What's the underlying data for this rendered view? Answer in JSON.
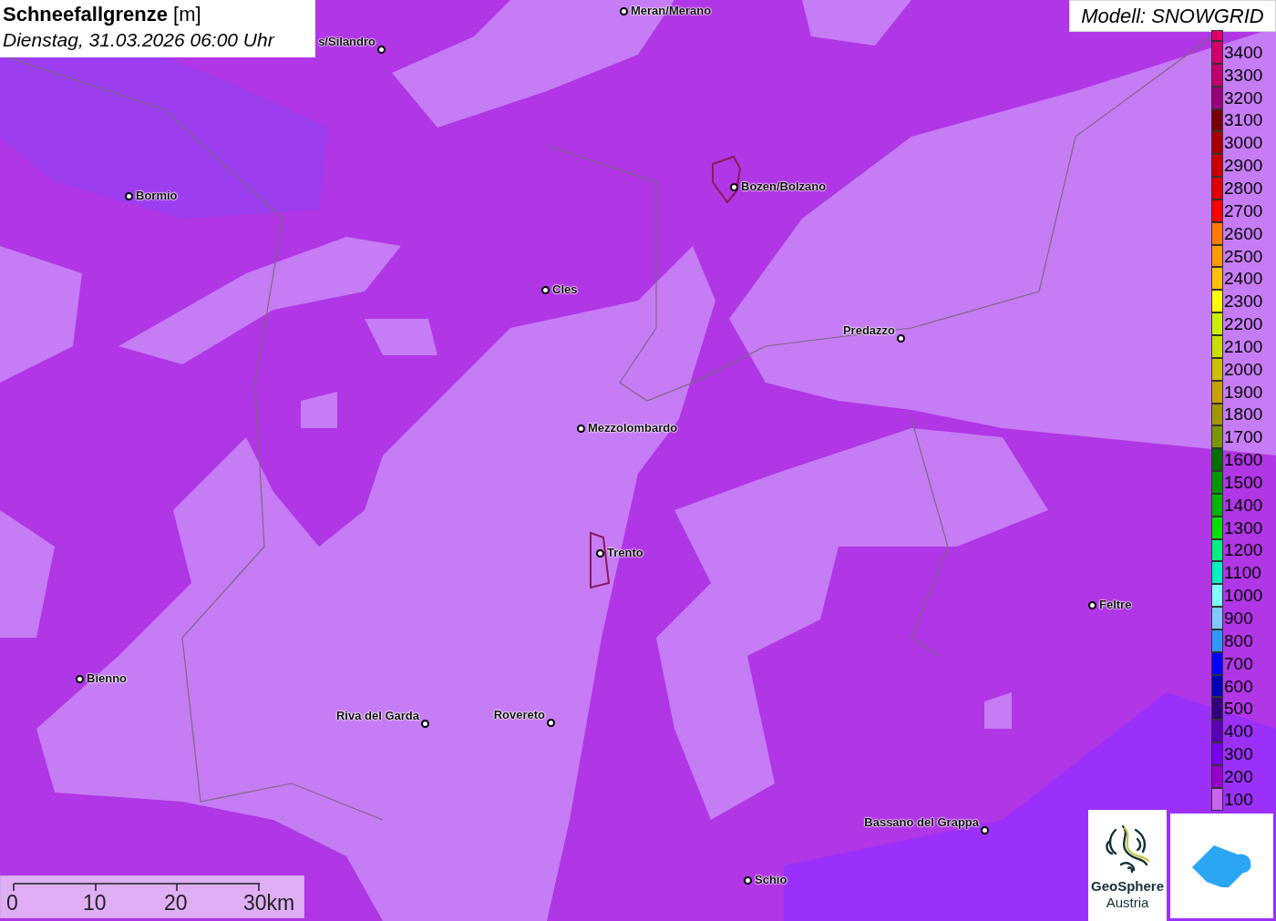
{
  "header": {
    "title": "**Schneefallgrenze** [m]",
    "subtitle": "Dienstag, 31.03.2026 06:00 Uhr"
  },
  "model_label": "Modell: SNOWGRID",
  "cities": [
    {
      "name": "Meran/Merano"
    },
    {
      "name": "s/Silandro"
    },
    {
      "name": "Bozen/Bolzano"
    },
    {
      "name": "Bormio"
    },
    {
      "name": "Cles"
    },
    {
      "name": "Predazzo"
    },
    {
      "name": "Mezzolombardo"
    },
    {
      "name": "Trento"
    },
    {
      "name": "Feltre"
    },
    {
      "name": "Bienno"
    },
    {
      "name": "Riva del Garda"
    },
    {
      "name": "Rovereto"
    },
    {
      "name": "Bassano del Grappa"
    },
    {
      "name": "Schio"
    }
  ],
  "legend": [
    {
      "label": "3400",
      "color": "#d4006a"
    },
    {
      "label": "3300",
      "color": "#c0006e"
    },
    {
      "label": "3200",
      "color": "#9a007a"
    },
    {
      "label": "3100",
      "color": "#7a0000"
    },
    {
      "label": "3000",
      "color": "#a80000"
    },
    {
      "label": "2900",
      "color": "#c80000"
    },
    {
      "label": "2800",
      "color": "#e00000"
    },
    {
      "label": "2700",
      "color": "#ff0000"
    },
    {
      "label": "2600",
      "color": "#ff7a00"
    },
    {
      "label": "2500",
      "color": "#ff9a00"
    },
    {
      "label": "2400",
      "color": "#ffc000"
    },
    {
      "label": "2300",
      "color": "#ffff00"
    },
    {
      "label": "2200",
      "color": "#c8f000"
    },
    {
      "label": "2100",
      "color": "#c8e000"
    },
    {
      "label": "2000",
      "color": "#c8c000"
    },
    {
      "label": "1900",
      "color": "#c8a000"
    },
    {
      "label": "1800",
      "color": "#a09600"
    },
    {
      "label": "1700",
      "color": "#789600"
    },
    {
      "label": "1600",
      "color": "#006e00"
    },
    {
      "label": "1500",
      "color": "#009600"
    },
    {
      "label": "1400",
      "color": "#00b400"
    },
    {
      "label": "1300",
      "color": "#00e000"
    },
    {
      "label": "1200",
      "color": "#00f080"
    },
    {
      "label": "1100",
      "color": "#00f0c0"
    },
    {
      "label": "1000",
      "color": "#80ffff"
    },
    {
      "label": "900",
      "color": "#80c8ff"
    },
    {
      "label": "800",
      "color": "#3296ff"
    },
    {
      "label": "700",
      "color": "#0000ff"
    },
    {
      "label": "600",
      "color": "#0000b4"
    },
    {
      "label": "500",
      "color": "#320078"
    },
    {
      "label": "400",
      "color": "#5a00b4"
    },
    {
      "label": "300",
      "color": "#7800f0"
    },
    {
      "label": "200",
      "color": "#9600c8"
    },
    {
      "label": "100",
      "color": "#c864f0"
    }
  ],
  "scale_bar": {
    "ticks": [
      "0",
      "10",
      "20",
      "30km"
    ]
  },
  "logo": {
    "name": "GeoSphere",
    "subtitle": "Austria"
  }
}
